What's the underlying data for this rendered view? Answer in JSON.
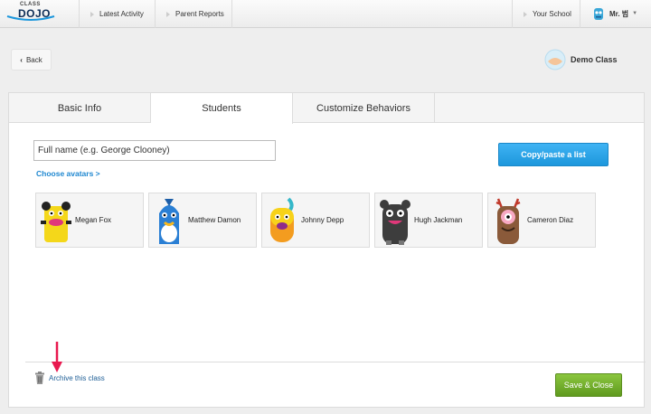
{
  "logo": {
    "small": "CLASS",
    "big": "DOJO"
  },
  "nav": {
    "latest_activity": "Latest Activity",
    "parent_reports": "Parent Reports",
    "your_school": "Your School",
    "user_name": "Mr. 범"
  },
  "back_label": "Back",
  "class_name": "Demo Class",
  "tabs": [
    {
      "label": "Basic Info"
    },
    {
      "label": "Students"
    },
    {
      "label": "Customize Behaviors"
    }
  ],
  "student_input": {
    "placeholder": "Full name (e.g. George Clooney)"
  },
  "choose_avatars": "Choose avatars >",
  "copy_paste_label": "Copy/paste a list",
  "students": [
    {
      "name": "Megan Fox",
      "avatar_color": "#f4d71a"
    },
    {
      "name": "Matthew Damon",
      "avatar_color": "#2a7fd4"
    },
    {
      "name": "Johnny Depp",
      "avatar_color": "#f39c1f"
    },
    {
      "name": "Hugh Jackman",
      "avatar_color": "#3d3d3d"
    },
    {
      "name": "Cameron Diaz",
      "avatar_color": "#8a5a3a"
    }
  ],
  "archive_label": "Archive this class",
  "save_label": "Save & Close",
  "colors": {
    "accent_blue": "#1d97dc",
    "save_green": "#6fae27",
    "pointer": "#e8194f"
  }
}
